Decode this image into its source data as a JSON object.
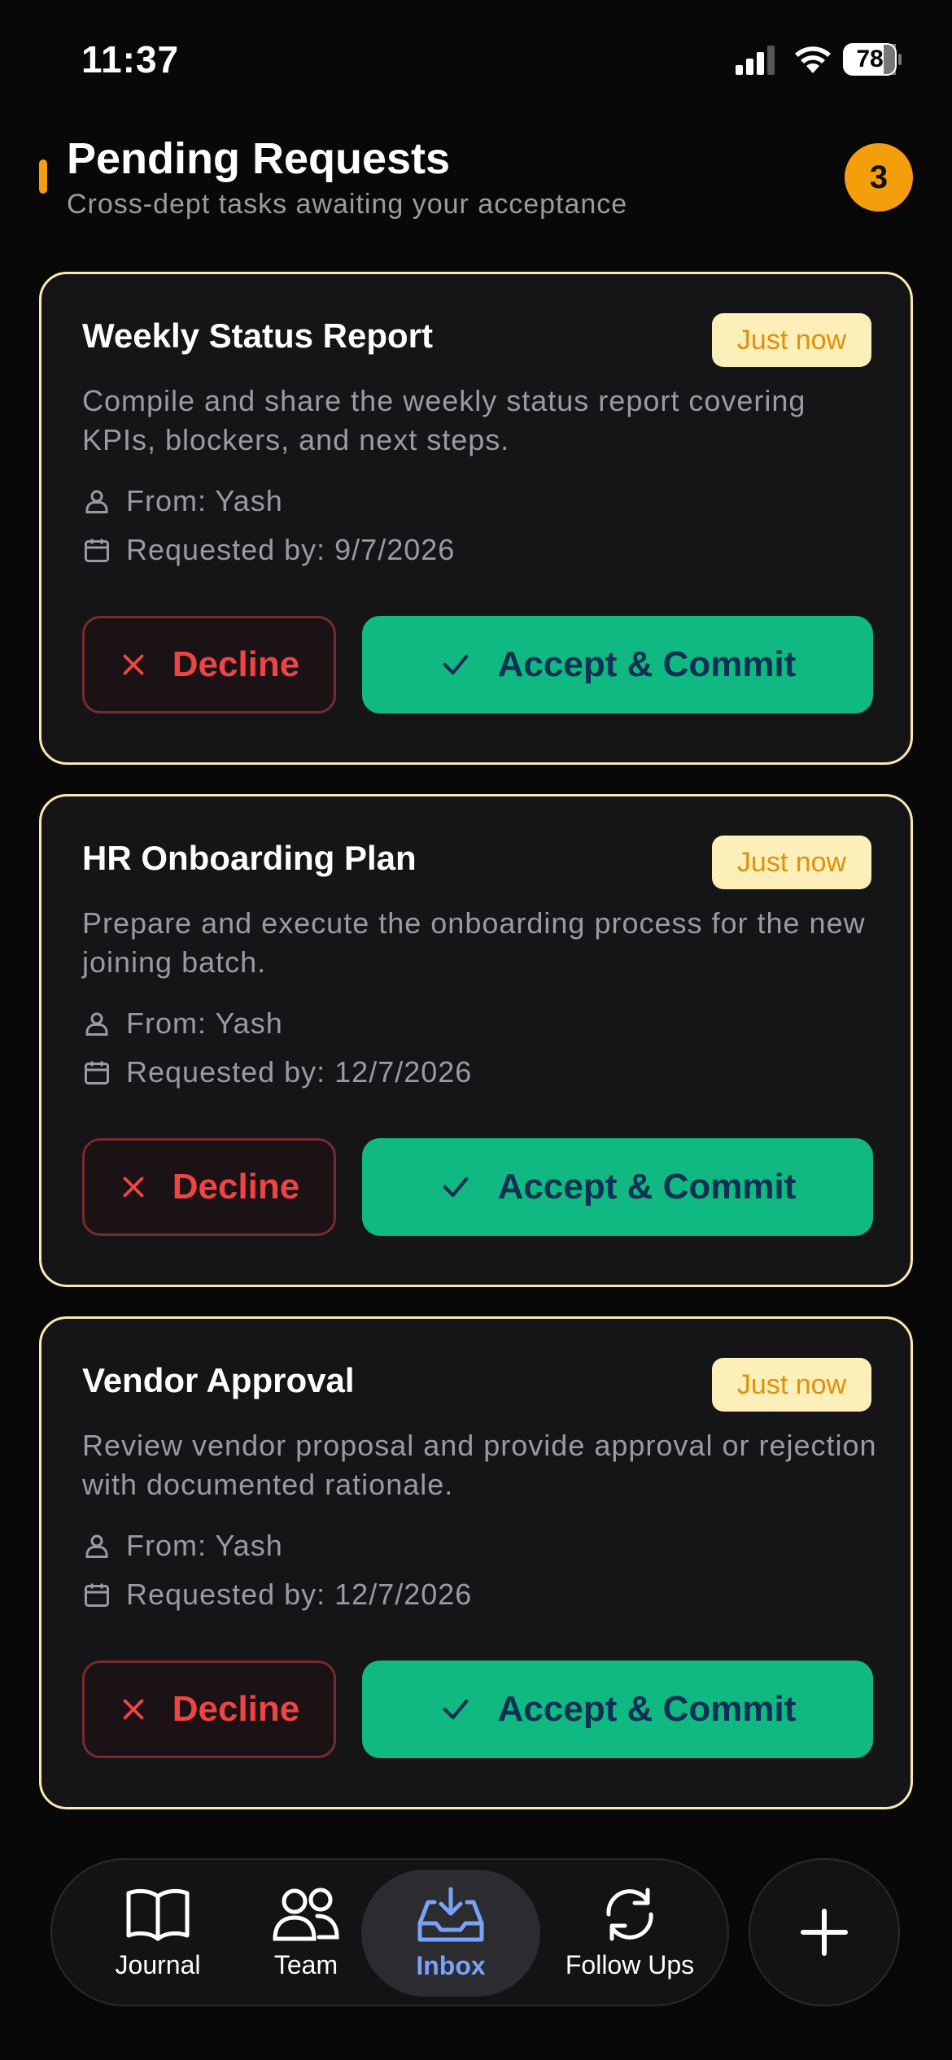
{
  "status_bar": {
    "time": "11:37",
    "battery": "78"
  },
  "header": {
    "title": "Pending Requests",
    "subtitle": "Cross-dept tasks awaiting your acceptance",
    "count": "3"
  },
  "requests": [
    {
      "title": "Weekly Status Report",
      "time_badge": "Just now",
      "description": "Compile and share the weekly status report covering KPIs, blockers, and next steps.",
      "from": "From: Yash",
      "requested_by": "Requested by: 9/7/2026",
      "decline_label": "Decline",
      "accept_label": "Accept & Commit"
    },
    {
      "title": "HR Onboarding Plan",
      "time_badge": "Just now",
      "description": "Prepare and execute the onboarding process for the new joining batch.",
      "from": "From: Yash",
      "requested_by": "Requested by: 12/7/2026",
      "decline_label": "Decline",
      "accept_label": "Accept & Commit"
    },
    {
      "title": "Vendor Approval",
      "time_badge": "Just now",
      "description": "Review vendor proposal and provide approval or rejection with documented rationale.",
      "from": "From: Yash",
      "requested_by": "Requested by: 12/7/2026",
      "decline_label": "Decline",
      "accept_label": "Accept & Commit"
    }
  ],
  "nav": {
    "items": [
      {
        "label": "Journal",
        "icon": "book-open-icon"
      },
      {
        "label": "Team",
        "icon": "users-icon"
      },
      {
        "label": "Inbox",
        "icon": "inbox-download-icon",
        "active": true
      },
      {
        "label": "Follow Ups",
        "icon": "refresh-icon"
      }
    ],
    "fab_icon": "plus-icon"
  },
  "colors": {
    "accent": "#f59e0b",
    "accept": "#10b981",
    "decline": "#ef4444",
    "active_nav": "#7aa2f7",
    "card_border": "#fbe9b0"
  }
}
